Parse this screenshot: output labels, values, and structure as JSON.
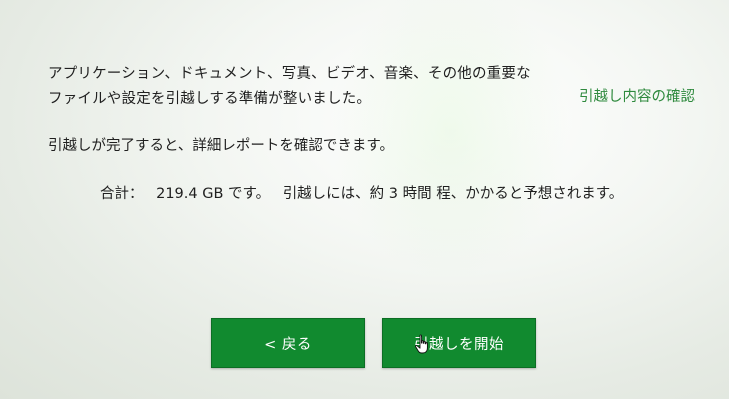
{
  "intro": {
    "line1": "アプリケーション、ドキュメント、写真、ビデオ、音楽、その他の重要な",
    "line2": "ファイルや設定を引越しする準備が整いました。"
  },
  "details_link": "引越し内容の確認",
  "notice": "引越しが完了すると、詳細レポートを確認できます。",
  "summary": {
    "total_label": "合計：",
    "total_value": "219.4 GB です。",
    "estimate_text": "引越しには、約 3 時間 程、かかると予想されます。"
  },
  "buttons": {
    "back_label": "< 戻る",
    "start_label": "引越しを開始"
  },
  "colors": {
    "accent_green": "#118a2f",
    "link_green": "#2f8a3e"
  },
  "icons": {
    "cursor": "hand-pointer-icon"
  }
}
